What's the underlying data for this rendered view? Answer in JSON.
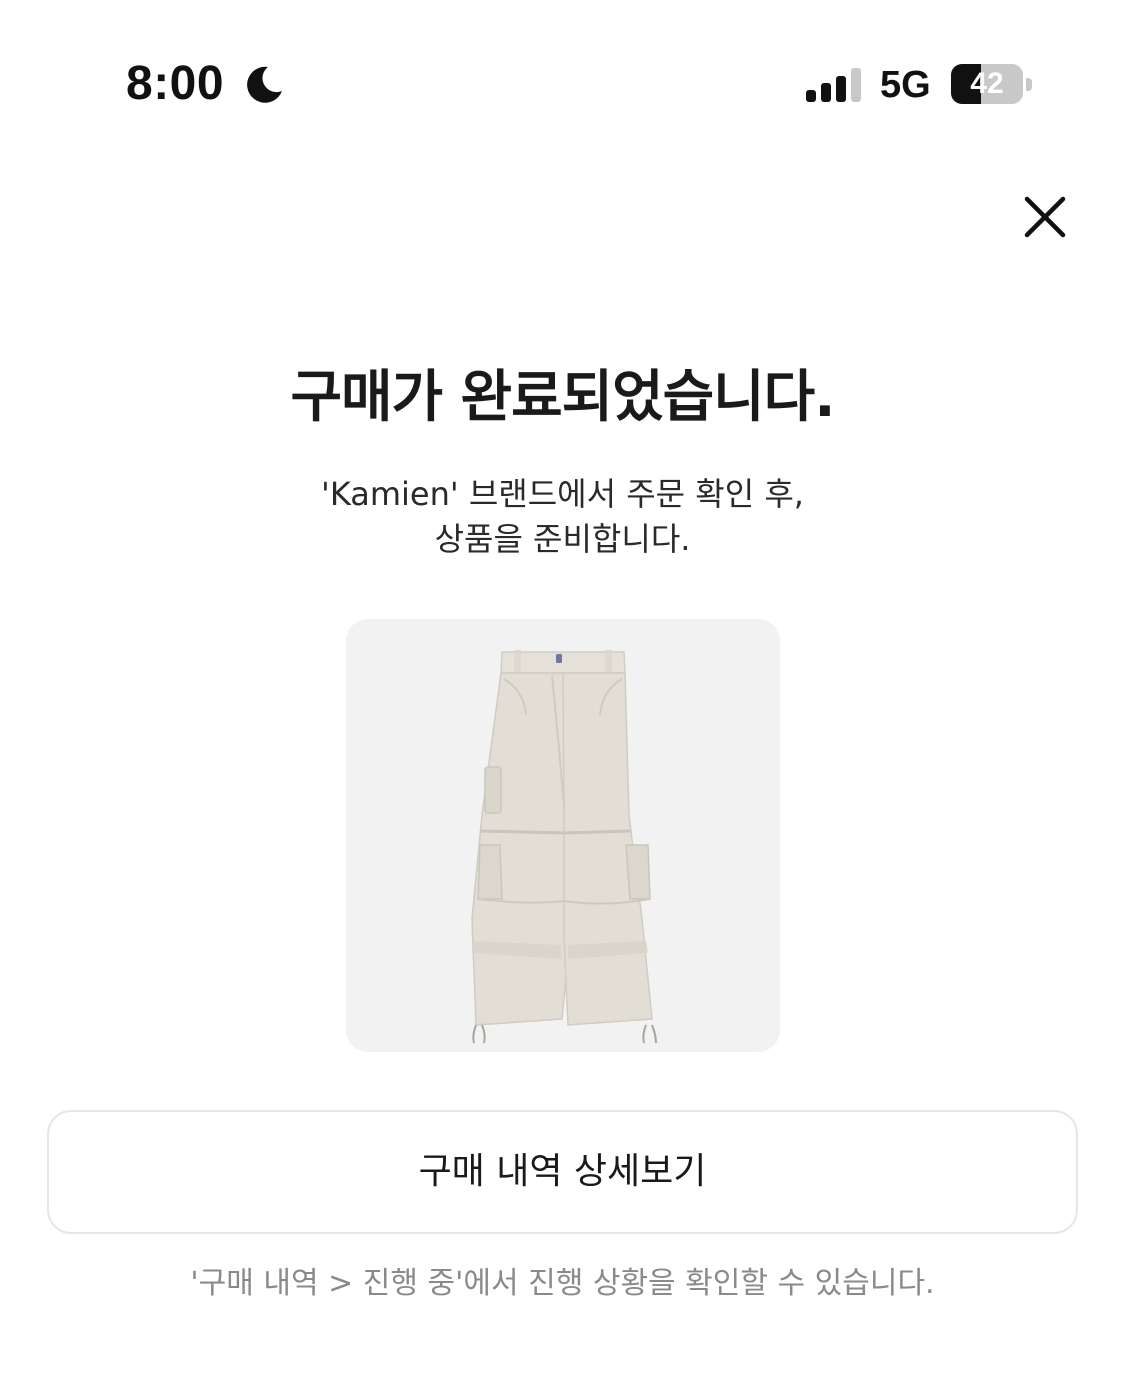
{
  "status_bar": {
    "time": "8:00",
    "network": "5G",
    "battery_level": 42,
    "battery_label": "42",
    "icons": [
      "moon-icon",
      "cellular-signal-icon",
      "battery-icon"
    ]
  },
  "header": {
    "close_icon": "close-icon"
  },
  "confirmation": {
    "title": "구매가 완료되었습니다.",
    "message_line_1": "'Kamien' 브랜드에서 주문 확인 후,",
    "message_line_2": "상품을 준비합니다."
  },
  "product": {
    "image": "cargo-pants",
    "color": "#e2ded5"
  },
  "actions": {
    "detail_button_label": "구매 내역 상세보기"
  },
  "footnote": "'구매 내역 > 진행 중'에서 진행 상황을 확인할 수 있습니다."
}
